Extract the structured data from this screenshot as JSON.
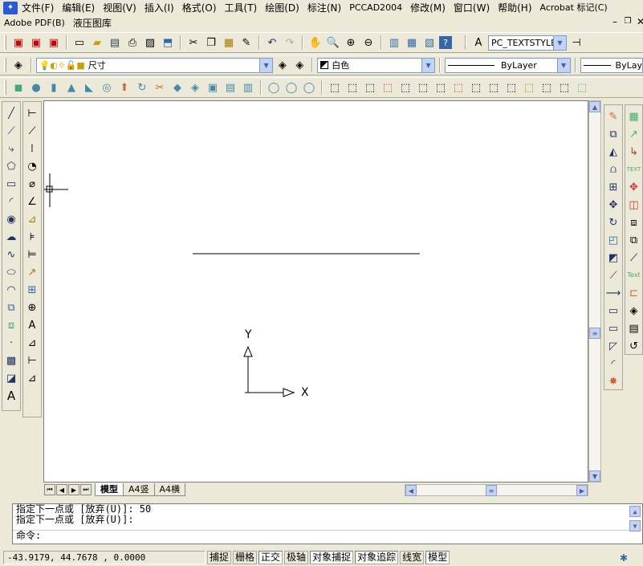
{
  "menu": {
    "items": [
      "文件(F)",
      "编辑(E)",
      "视图(V)",
      "插入(I)",
      "格式(O)",
      "工具(T)",
      "绘图(D)",
      "标注(N)",
      "PCCAD2004",
      "修改(M)",
      "窗口(W)",
      "帮助(H)",
      "Acrobat 标记(C)"
    ],
    "items2": [
      "Adobe PDF(B)",
      "液压图库"
    ]
  },
  "layer": {
    "name": "尺寸"
  },
  "color": {
    "name": "白色"
  },
  "linetype": {
    "name": "ByLayer",
    "name2": "ByLay"
  },
  "textstyle": {
    "name": "PC_TEXTSTYLE"
  },
  "axis": {
    "x": "X",
    "y": "Y"
  },
  "tabs": [
    "模型",
    "A4竖",
    "A4横"
  ],
  "command": {
    "lines": [
      "指定下一点或 [放弃(U)]: 50",
      "指定下一点或 [放弃(U)]:",
      "命令:"
    ]
  },
  "status": {
    "coords": "-43.9179, 44.7678 , 0.0000",
    "buttons": [
      {
        "label": "捕捉",
        "on": false
      },
      {
        "label": "栅格",
        "on": false
      },
      {
        "label": "正交",
        "on": true
      },
      {
        "label": "极轴",
        "on": false
      },
      {
        "label": "对象捕捉",
        "on": true
      },
      {
        "label": "对象追踪",
        "on": true
      },
      {
        "label": "线宽",
        "on": false
      },
      {
        "label": "模型",
        "on": true
      }
    ]
  },
  "colors": {
    "canvas": "#ffffff",
    "chrome": "#ece9d8",
    "accent": "#316ac5"
  },
  "icons": {
    "std": [
      "new-icon",
      "open-icon",
      "save-icon",
      "print-icon",
      "preview-icon",
      "publish-icon",
      "cut-icon",
      "copy-icon",
      "paste-icon",
      "match-icon",
      "undo-icon",
      "redo-icon",
      "pan-icon",
      "zoom-realtime-icon",
      "zoom-window-icon",
      "zoom-previous-icon",
      "properties-icon",
      "designcenter-icon",
      "toolpalette-icon",
      "help-icon"
    ],
    "left_draw": [
      "line-icon",
      "construction-line-icon",
      "polyline-icon",
      "polygon-icon",
      "rectangle-icon",
      "arc-icon",
      "circle-icon",
      "cloud-icon",
      "spline-icon",
      "ellipse-icon",
      "ellipse-arc-icon",
      "insert-block-icon",
      "make-block-icon",
      "point-icon",
      "hatch-icon",
      "region-icon",
      "text-icon"
    ],
    "right_modify": [
      "erase-icon",
      "copy-object-icon",
      "mirror-icon",
      "offset-icon",
      "array-icon",
      "move-icon",
      "rotate-icon",
      "scale-icon",
      "stretch-icon",
      "trim-icon",
      "extend-icon",
      "break-icon",
      "join-icon",
      "chamfer-icon",
      "fillet-icon",
      "explode-icon"
    ]
  }
}
